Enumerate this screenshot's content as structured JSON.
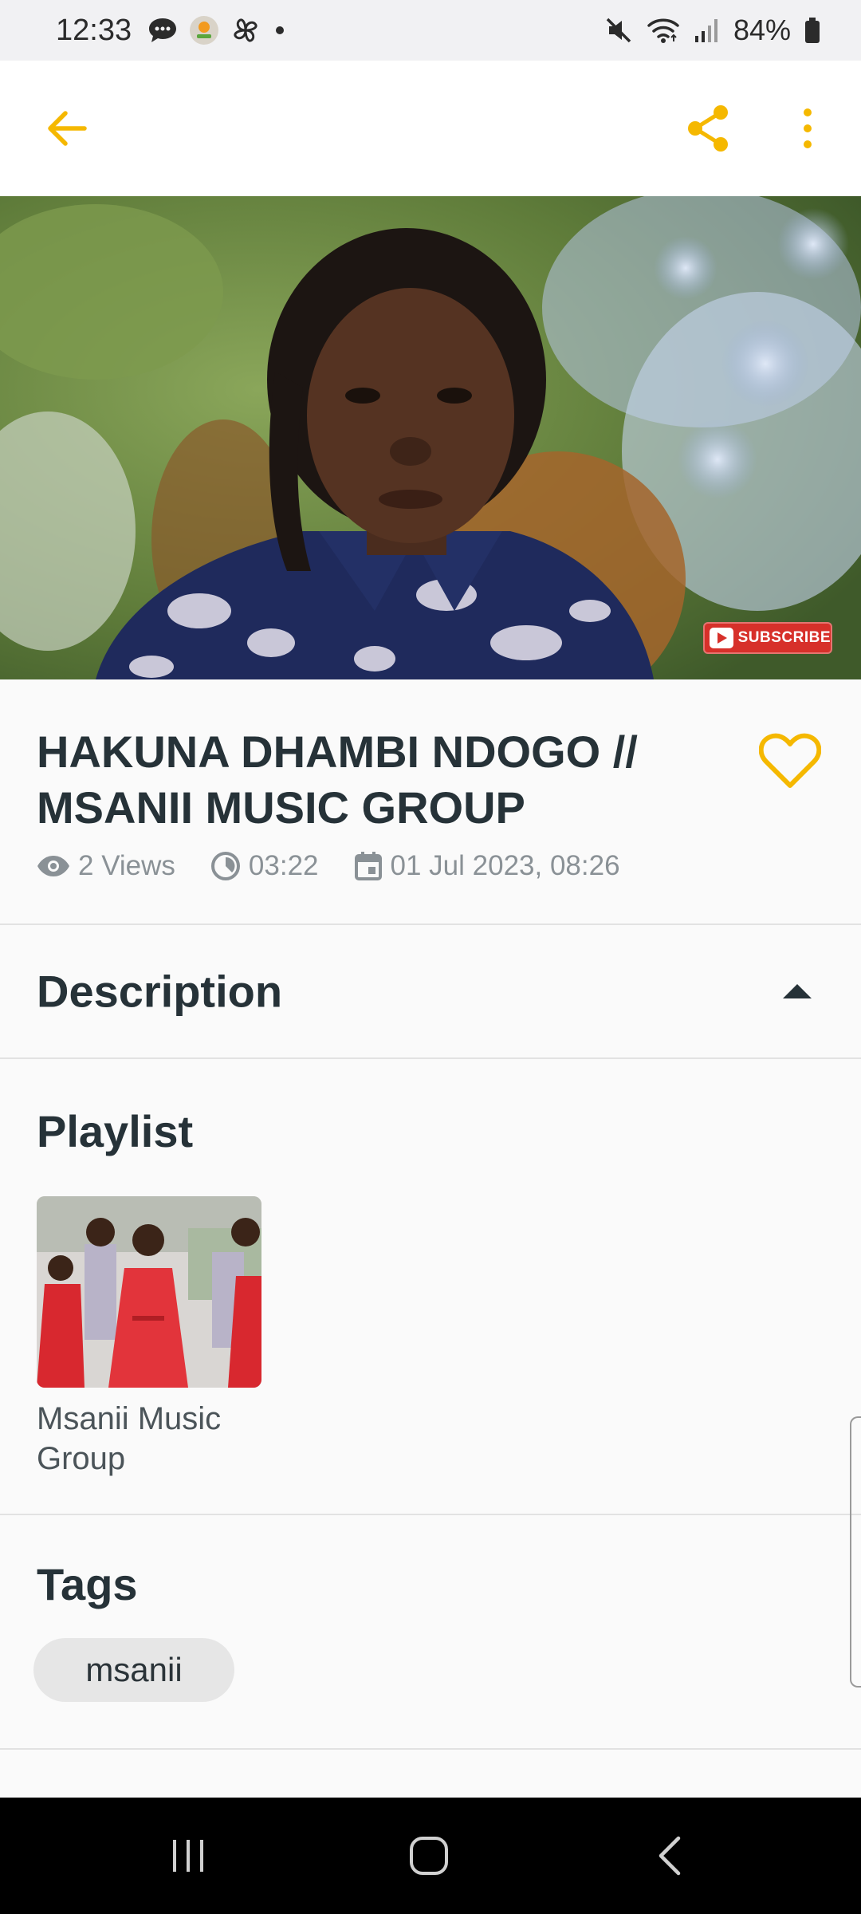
{
  "status_bar": {
    "time": "12:33",
    "battery": "84%",
    "left_icons": [
      "chat-bubble-icon",
      "app-badge-icon",
      "pinwheel-icon",
      "dot-icon"
    ],
    "right_icons": [
      "mute-icon",
      "wifi-icon",
      "signal-icon",
      "battery-icon"
    ]
  },
  "app_bar": {
    "back_icon": "arrow-back-icon",
    "share_icon": "share-icon",
    "more_icon": "more-vertical-icon",
    "accent": "#f5b800"
  },
  "video": {
    "subscribe_label": "SUBSCRIBE"
  },
  "details": {
    "title": "HAKUNA DHAMBI NDOGO // MSANII MUSIC GROUP",
    "views": "2 Views",
    "duration": "03:22",
    "date": "01 Jul 2023, 08:26"
  },
  "description": {
    "title": "Description"
  },
  "playlist": {
    "title": "Playlist",
    "items": [
      {
        "name": "Msanii Music Group"
      }
    ]
  },
  "tags": {
    "title": "Tags",
    "items": [
      "msanii"
    ]
  },
  "colors": {
    "accent": "#f5b800",
    "text": "#263238",
    "muted": "#8a9196"
  }
}
